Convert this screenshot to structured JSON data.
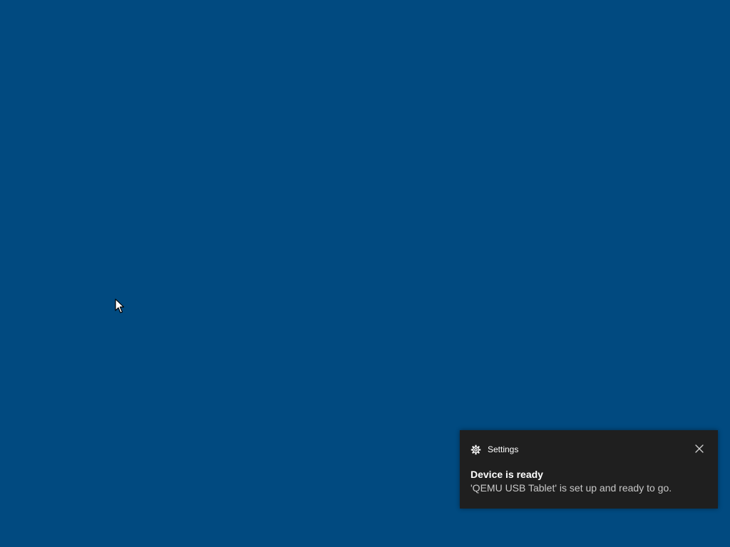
{
  "desktop": {
    "background_color": "#014a80"
  },
  "cursor": {
    "icon": "arrow-cursor-icon"
  },
  "notification": {
    "app_icon": "gear-icon",
    "app_name": "Settings",
    "close_icon": "close-icon",
    "title": "Device is ready",
    "body": "'QEMU USB Tablet' is set up and ready to go.",
    "background_color": "#1f1f1f"
  }
}
